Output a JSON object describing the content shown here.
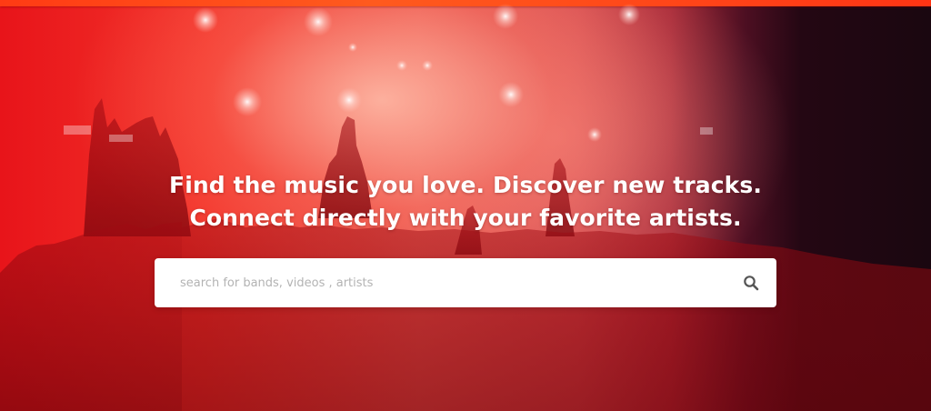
{
  "hero": {
    "headline_line1": "Find the music you love. Discover new tracks.",
    "headline_line2": "Connect directly with your favorite artists.",
    "background_image": "concert-crowd-photo",
    "accent_color": "#ff3b14",
    "overlay_color": "#e8141a",
    "dark_color": "#1a0710"
  },
  "search": {
    "placeholder": "search for bands, videos , artists",
    "value": "",
    "icon": "search-icon"
  }
}
